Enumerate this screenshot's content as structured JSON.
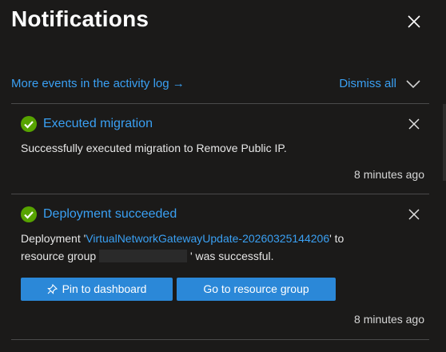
{
  "panel": {
    "title": "Notifications",
    "activity_link": "More events in the activity log",
    "activity_arrow": "→",
    "dismiss_all": "Dismiss all"
  },
  "notifications": [
    {
      "title": "Executed migration",
      "message": "Successfully executed migration to Remove Public IP.",
      "time": "8 minutes ago",
      "status_icon": "success-check-icon"
    },
    {
      "title": "Deployment succeeded",
      "message_prefix": "Deployment '",
      "deployment_name": "VirtualNetworkGatewayUpdate-20260325144206",
      "message_mid": "' to",
      "message_rg_prefix": "resource group",
      "message_suffix": "' was successful.",
      "time": "8 minutes ago",
      "status_icon": "success-check-icon",
      "buttons": {
        "pin": "Pin to dashboard",
        "go_rg": "Go to resource group"
      }
    }
  ],
  "colors": {
    "background": "#1b1a19",
    "link": "#3aa0f3",
    "success": "#57a300",
    "button": "#2b88d8"
  }
}
